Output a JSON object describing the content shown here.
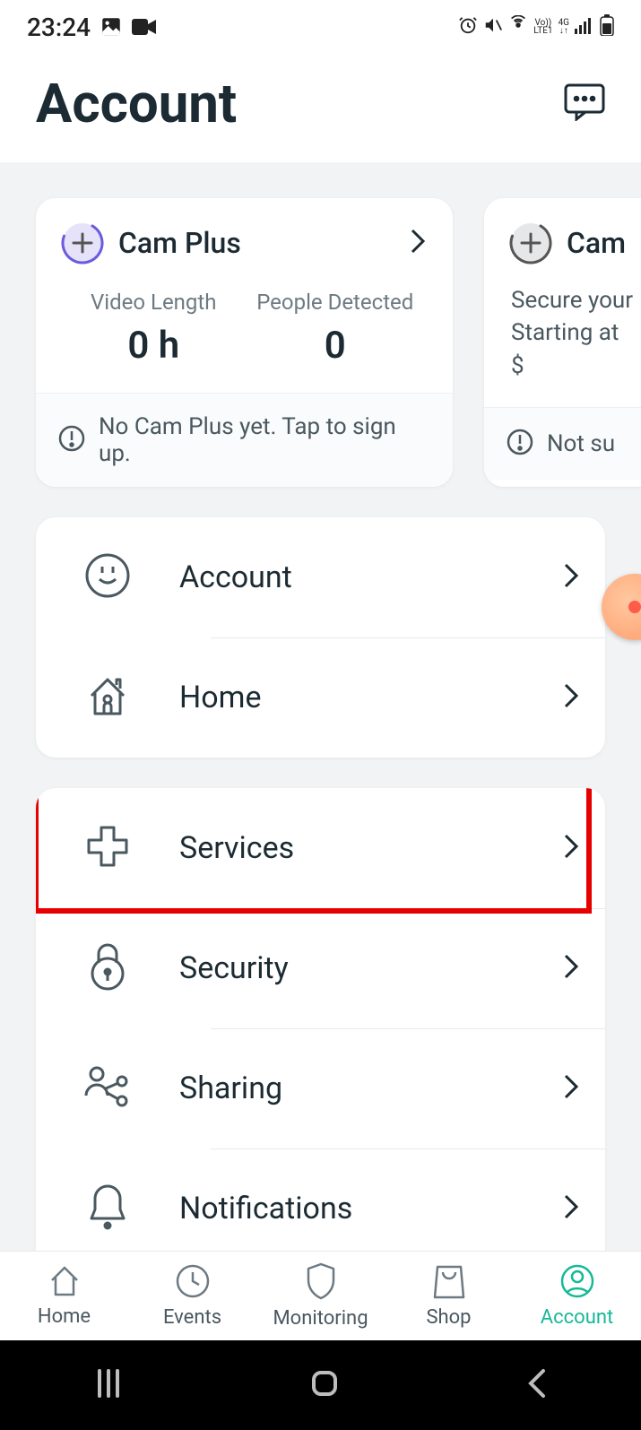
{
  "status": {
    "time": "23:24"
  },
  "header": {
    "title": "Account"
  },
  "cards": [
    {
      "title": "Cam Plus",
      "stats": [
        {
          "label": "Video Length",
          "value": "0 h"
        },
        {
          "label": "People Detected",
          "value": "0"
        }
      ],
      "footer": "No Cam Plus yet. Tap to sign up."
    },
    {
      "title": "Cam",
      "desc": "Secure your\nStarting at $",
      "footer": "Not su"
    }
  ],
  "menu_group1": [
    {
      "label": "Account",
      "icon": "smile"
    },
    {
      "label": "Home",
      "icon": "house"
    }
  ],
  "menu_group2": [
    {
      "label": "Services",
      "icon": "plus-cross",
      "highlighted": true
    },
    {
      "label": "Security",
      "icon": "lock"
    },
    {
      "label": "Sharing",
      "icon": "share-people"
    },
    {
      "label": "Notifications",
      "icon": "bell"
    }
  ],
  "tabs": [
    {
      "label": "Home"
    },
    {
      "label": "Events"
    },
    {
      "label": "Monitoring"
    },
    {
      "label": "Shop"
    },
    {
      "label": "Account",
      "active": true
    }
  ]
}
